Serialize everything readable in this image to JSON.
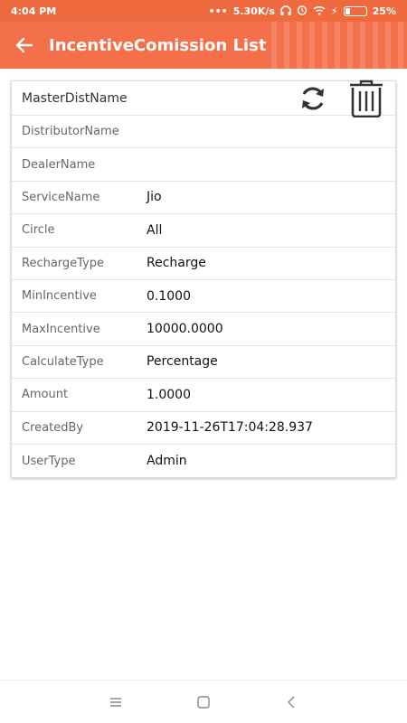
{
  "status_bar": {
    "time": "4:04 PM",
    "network_speed": "5.30K/s",
    "battery_percent": "25%",
    "battery_level": 0.25
  },
  "app_bar": {
    "title": "IncentiveComission List",
    "back_icon": "arrow-left-icon"
  },
  "card": {
    "header_label": "MasterDistName",
    "refresh_icon": "refresh-icon",
    "delete_icon": "trash-icon",
    "rows": [
      {
        "label": "DistributorName",
        "value": ""
      },
      {
        "label": "DealerName",
        "value": ""
      },
      {
        "label": "ServiceName",
        "value": "Jio"
      },
      {
        "label": "Circle",
        "value": "All"
      },
      {
        "label": "RechargeType",
        "value": "Recharge"
      },
      {
        "label": "MinIncentive",
        "value": "0.1000"
      },
      {
        "label": "MaxIncentive",
        "value": "10000.0000"
      },
      {
        "label": "CalculateType",
        "value": "Percentage"
      },
      {
        "label": "Amount",
        "value": "1.0000"
      },
      {
        "label": "CreatedBy",
        "value": "2019-11-26T17:04:28.937"
      },
      {
        "label": "UserType",
        "value": "Admin"
      }
    ]
  },
  "colors": {
    "status_bar": "#f06a3f",
    "app_bar": "#f4704a"
  }
}
